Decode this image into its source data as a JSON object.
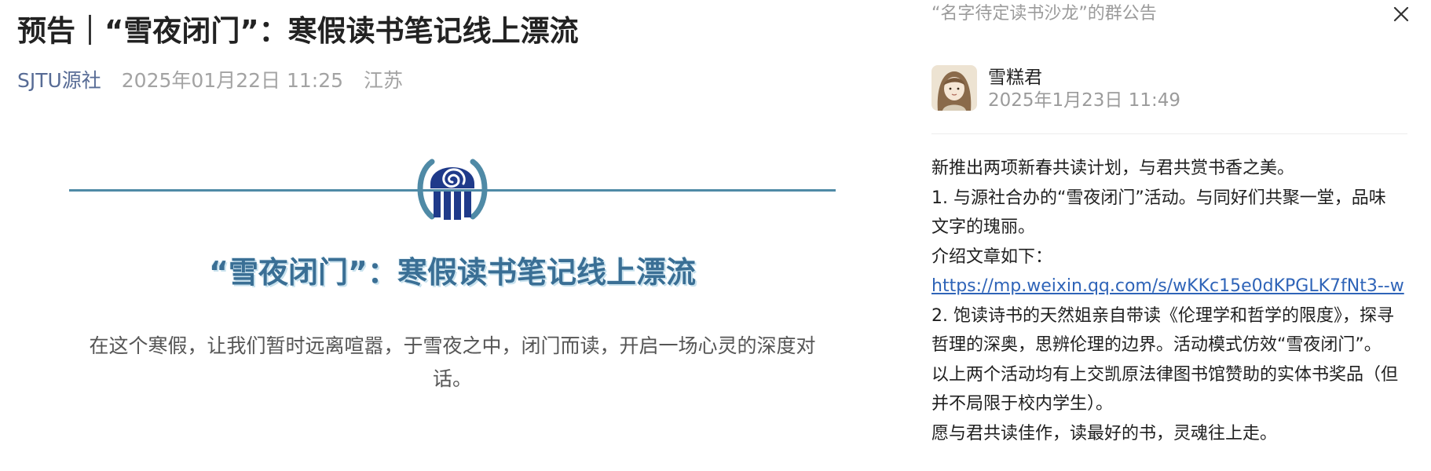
{
  "article": {
    "title": "预告｜“雪夜闭门”：寒假读书笔记线上漂流",
    "author": "SJTU源社",
    "date": "2025年01月22日 11:25",
    "location": "江苏",
    "banner_title": "“雪夜闭门”：寒假读书笔记线上漂流",
    "banner_desc": "在这个寒假，让我们暂时远离喧嚣，于雪夜之中，闭门而读，开启一场心灵的深度对话。",
    "logo_icon": "spiral-seal-logo-icon"
  },
  "panel": {
    "title": "“名字待定读书沙龙”的群公告",
    "close_icon": "close-icon",
    "poster_name": "雪糕君",
    "post_time": "2025年1月23日 11:49",
    "content": [
      "新推出两项新春共读计划，与君共赏书香之美。",
      "1. 与源社合办的“雪夜闭门”活动。与同好们共聚一堂，品味",
      "文字的瑰丽。",
      "介绍文章如下：",
      "https://mp.weixin.qq.com/s/wKKc15e0dKPGLK7fNt3--w",
      "2. 饱读诗书的天然姐亲自带读《伦理学和哲学的限度》，探寻",
      "哲理的深奥，思辨伦理的边界。活动模式仿效“雪夜闭门”。",
      "以上两个活动均有上交凯原法律图书馆赞助的实体书奖品（但",
      "并不局限于校内学生）。",
      "愿与君共读佳作，读最好的书，灵魂往上走。"
    ]
  },
  "colors": {
    "author_link": "#576b95",
    "banner_accent": "#3a6f95",
    "logo_navy": "#1f3a8a",
    "link": "#2f64b8"
  }
}
